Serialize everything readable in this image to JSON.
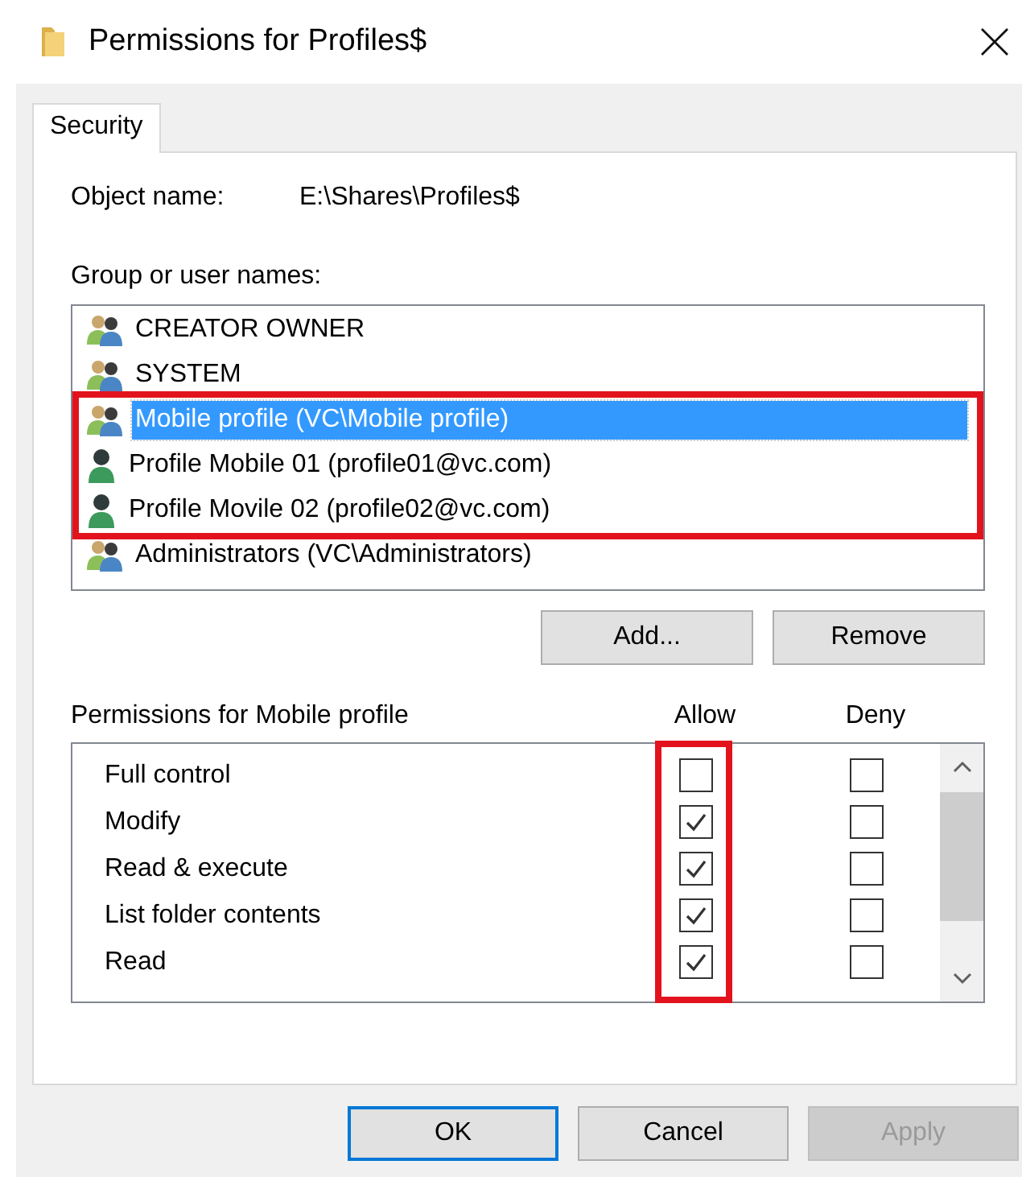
{
  "window": {
    "title": "Permissions for Profiles$"
  },
  "tabs": [
    {
      "label": "Security",
      "selected": true
    }
  ],
  "object_name": {
    "label": "Object name:",
    "value": "E:\\Shares\\Profiles$"
  },
  "users": {
    "label": "Group or user names:",
    "items": [
      {
        "name": "CREATOR OWNER",
        "kind": "group",
        "selected": false,
        "highlighted": false
      },
      {
        "name": "SYSTEM",
        "kind": "group",
        "selected": false,
        "highlighted": false
      },
      {
        "name": "Mobile profile (VC\\Mobile profile)",
        "kind": "group",
        "selected": true,
        "highlighted": true
      },
      {
        "name": "Profile Mobile 01 (profile01@vc.com)",
        "kind": "user",
        "selected": false,
        "highlighted": true
      },
      {
        "name": "Profile Movile 02 (profile02@vc.com)",
        "kind": "user",
        "selected": false,
        "highlighted": true
      },
      {
        "name": "Administrators (VC\\Administrators)",
        "kind": "group",
        "selected": false,
        "highlighted": false
      }
    ]
  },
  "user_buttons": [
    {
      "label": "Add..."
    },
    {
      "label": "Remove"
    }
  ],
  "permissions": {
    "label": "Permissions for Mobile profile",
    "columns": [
      {
        "label": "Allow"
      },
      {
        "label": "Deny"
      }
    ],
    "allow_column_highlighted": true,
    "rows": [
      {
        "name": "Full control",
        "allow": false,
        "deny": false
      },
      {
        "name": "Modify",
        "allow": true,
        "deny": false
      },
      {
        "name": "Read & execute",
        "allow": true,
        "deny": false
      },
      {
        "name": "List folder contents",
        "allow": true,
        "deny": false
      },
      {
        "name": "Read",
        "allow": true,
        "deny": false
      }
    ]
  },
  "buttons": [
    {
      "label": "OK",
      "kind": "default",
      "disabled": false
    },
    {
      "label": "Cancel",
      "kind": "normal",
      "disabled": false
    },
    {
      "label": "Apply",
      "kind": "normal",
      "disabled": true
    }
  ]
}
